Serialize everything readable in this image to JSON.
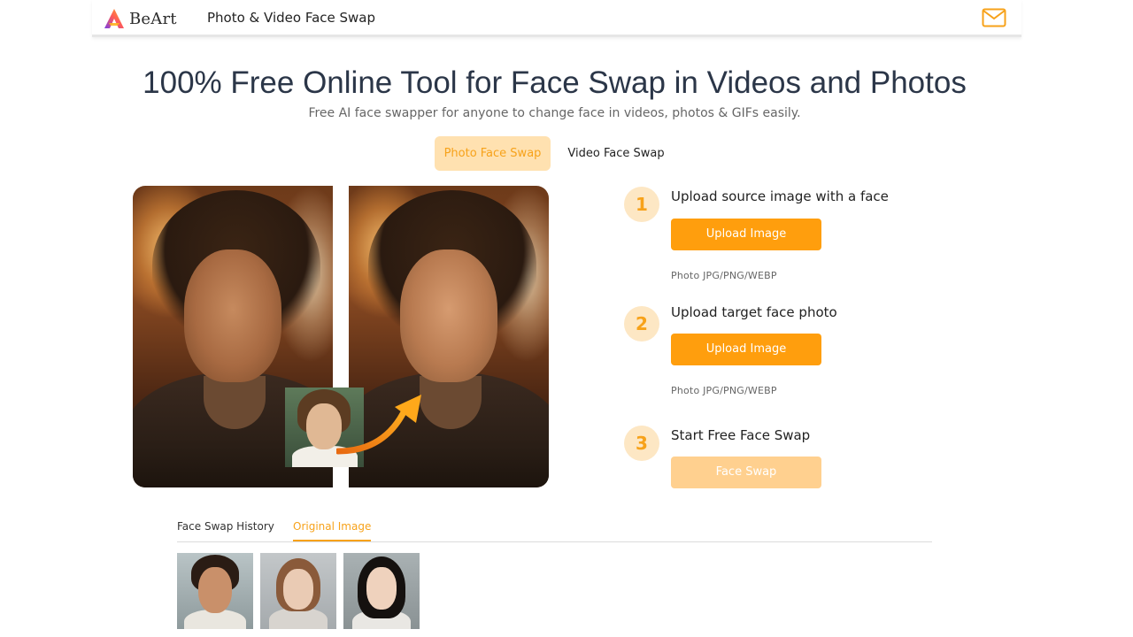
{
  "header": {
    "logo_text": "BeArt",
    "nav_title": "Photo & Video Face Swap",
    "mail_icon": "mail-icon"
  },
  "hero": {
    "title": "100% Free Online Tool for Face Swap in Videos and Photos",
    "subtitle": "Free AI face swapper for anyone to change face in videos, photos & GIFs easily."
  },
  "mode_tabs": [
    {
      "label": "Photo Face Swap",
      "active": true
    },
    {
      "label": "Video Face Swap",
      "active": false
    }
  ],
  "steps": [
    {
      "number": "1",
      "title": "Upload source image with a face",
      "button": "Upload Image",
      "hint": "Photo JPG/PNG/WEBP"
    },
    {
      "number": "2",
      "title": "Upload target face photo",
      "button": "Upload Image",
      "hint": "Photo JPG/PNG/WEBP"
    },
    {
      "number": "3",
      "title": "Start Free Face Swap",
      "button": "Face Swap"
    }
  ],
  "history": {
    "tabs": [
      {
        "label": "Face Swap History",
        "active": false
      },
      {
        "label": "Original Image",
        "active": true
      }
    ]
  },
  "colors": {
    "accent": "#ff9e0d",
    "accent_light": "#ffe1b0",
    "accent_text": "#f7a21a"
  }
}
